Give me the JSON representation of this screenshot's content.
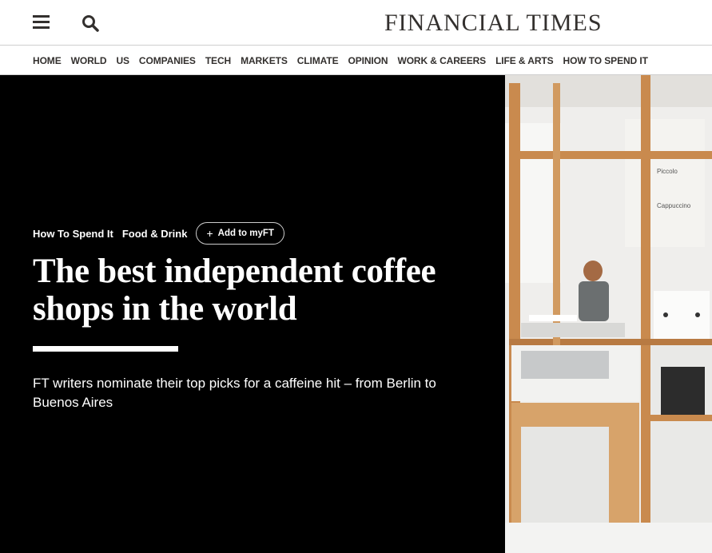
{
  "header": {
    "logo_text": "FINANCIAL TIMES",
    "menu_icon": "hamburger-menu-icon",
    "search_icon": "search-icon"
  },
  "nav": {
    "items": [
      "HOME",
      "WORLD",
      "US",
      "COMPANIES",
      "TECH",
      "MARKETS",
      "CLIMATE",
      "OPINION",
      "WORK & CAREERS",
      "LIFE & ARTS",
      "HOW TO SPEND IT"
    ]
  },
  "article": {
    "tag_primary": "How To Spend It",
    "tag_secondary": "Food & Drink",
    "myft_label": "Add to myFT",
    "headline": "The best independent coffee shops in the world",
    "standfirst": "FT writers nominate their top picks for a caffeine hit – from Berlin to Buenos Aires"
  },
  "photo": {
    "menu_board": [
      "Piccolo",
      "Cappuccino"
    ]
  },
  "colors": {
    "hero_bg": "#000000",
    "text_dark": "#33302e",
    "wood": "#c98a4e"
  }
}
